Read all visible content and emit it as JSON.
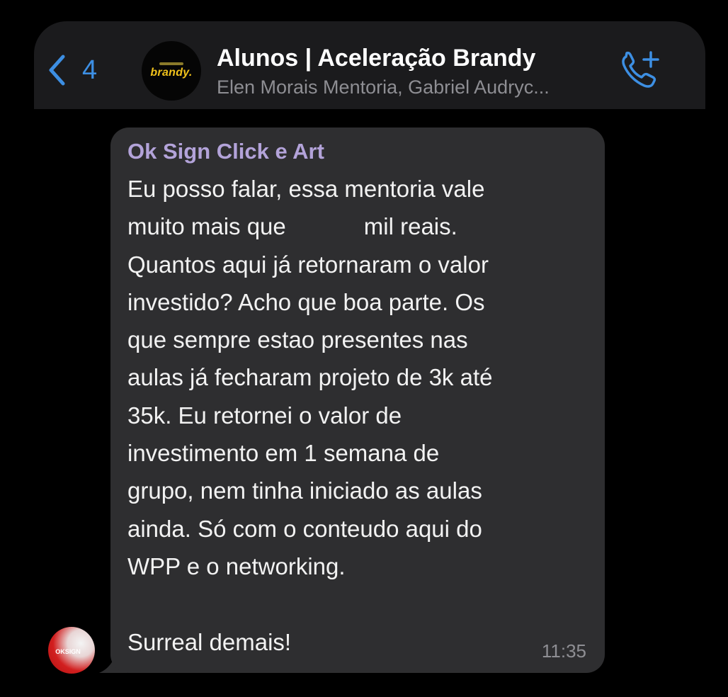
{
  "header": {
    "back_count": "4",
    "avatar_brand": "brandy.",
    "title": "Alunos | Aceleração Brandy",
    "subtitle": "Elen Morais Mentoria, Gabriel Audryc..."
  },
  "message": {
    "sender": "Ok Sign Click e Art",
    "lines": [
      "Eu posso falar, essa mentoria vale",
      "muito mais que            mil reais.",
      "Quantos aqui já retornaram o valor",
      "investido? Acho que boa parte. Os",
      "que sempre estao presentes nas",
      "aulas já fecharam projeto de 3k até",
      "35k. Eu retornei o valor de",
      "investimento em 1 semana de",
      "grupo, nem tinha iniciado as aulas",
      "ainda. Só com o conteudo aqui do",
      "WPP e o networking.",
      "",
      "Surreal demais!"
    ],
    "time": "11:35"
  },
  "sender_avatar": {
    "label": "OKSIGN"
  },
  "colors": {
    "accent": "#3d8fe3",
    "bubble": "#2e2e30",
    "sender_name": "#b3a3d9",
    "header_bg": "#1b1b1d"
  },
  "icons": {
    "back": "chevron-left-icon",
    "call": "add-call-icon"
  }
}
